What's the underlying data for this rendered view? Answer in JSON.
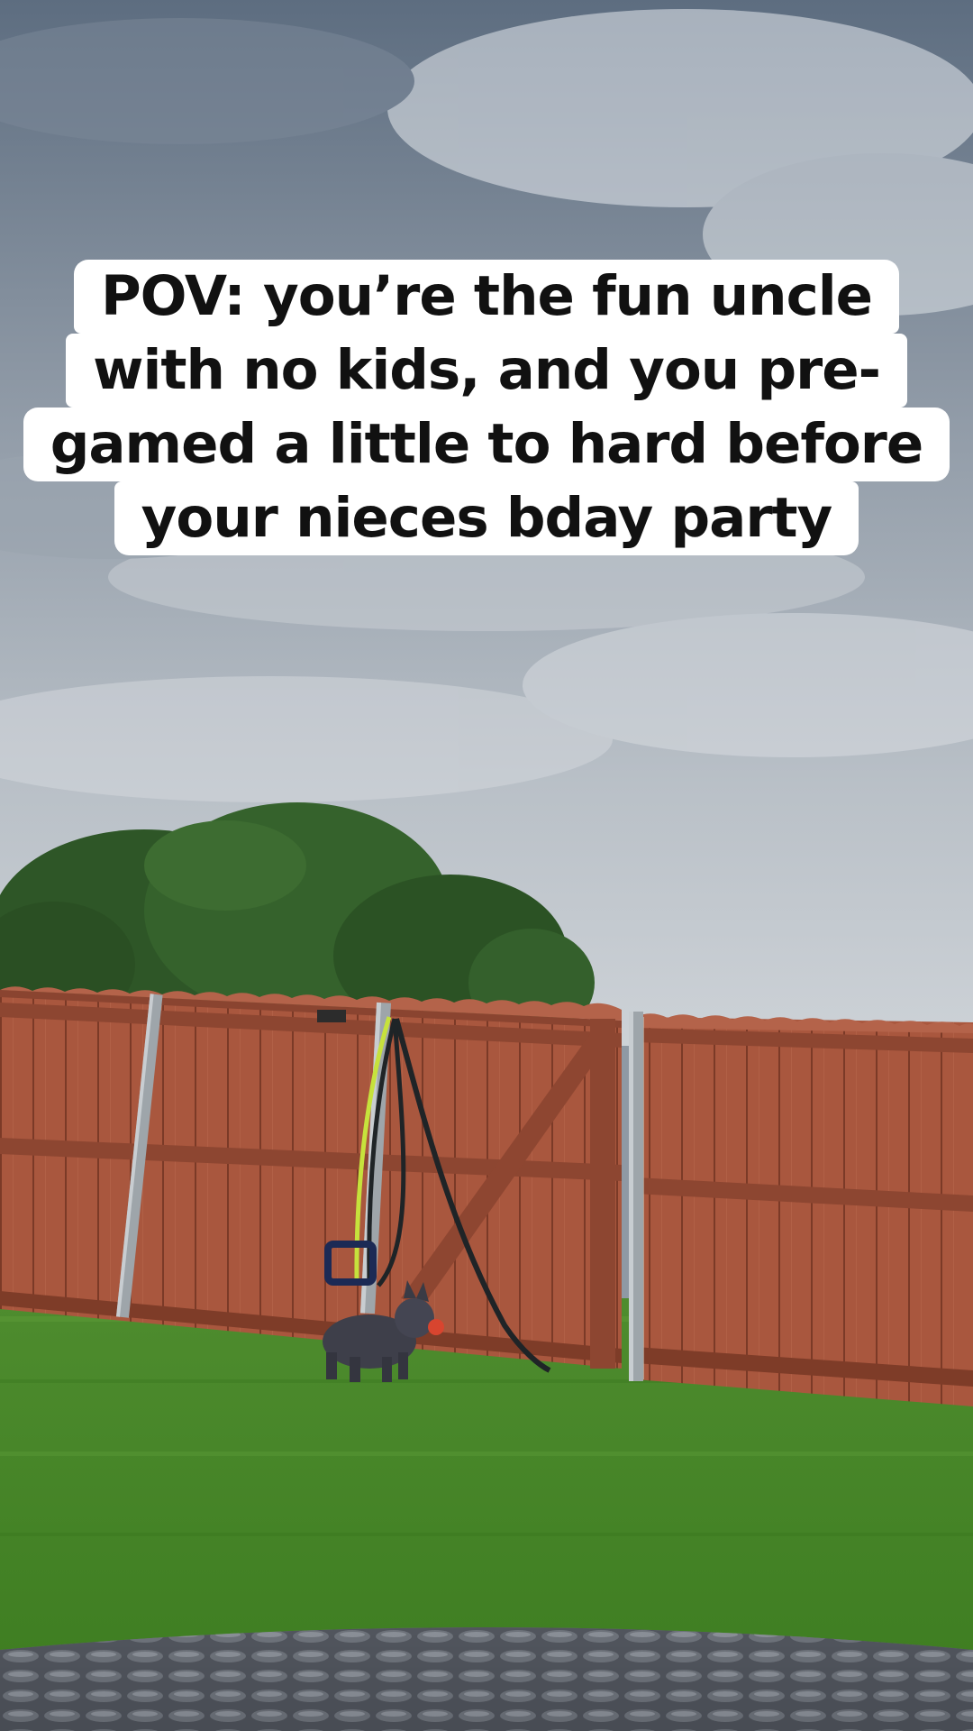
{
  "caption": {
    "lines": [
      "POV: you’re the fun uncle",
      "with no kids, and you pre-",
      "gamed a little to hard before",
      "your nieces bday party"
    ]
  },
  "scene": {
    "colors": {
      "sky_top": "#5f6f81",
      "sky_bottom": "#c9ced3",
      "fence": "#a8553c",
      "fence_dark": "#7e3b28",
      "grass": "#4c8f2c",
      "tree": "#2f5a28",
      "post": "#9ca3a8",
      "hose": "#1e2326",
      "hose_accent": "#c8e43a",
      "dog": "#3d3e48",
      "toy": "#d8452f",
      "trampoline_mat": "#3f434a"
    }
  }
}
